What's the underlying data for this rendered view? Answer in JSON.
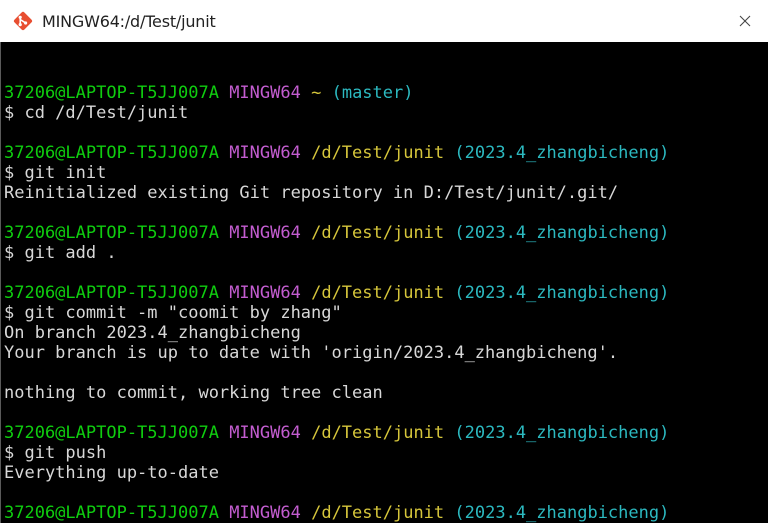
{
  "window": {
    "title": "MINGW64:/d/Test/junit"
  },
  "terminal": {
    "lines": [
      {
        "type": "blank"
      },
      {
        "type": "prompt",
        "user": "37206@LAPTOP-T5JJ007A",
        "sys": "MINGW64",
        "path": "~",
        "branch": "(master)"
      },
      {
        "type": "text",
        "text": "$ cd /d/Test/junit"
      },
      {
        "type": "blank"
      },
      {
        "type": "prompt",
        "user": "37206@LAPTOP-T5JJ007A",
        "sys": "MINGW64",
        "path": "/d/Test/junit",
        "branch": "(2023.4_zhangbicheng)"
      },
      {
        "type": "text",
        "text": "$ git init"
      },
      {
        "type": "text",
        "text": "Reinitialized existing Git repository in D:/Test/junit/.git/"
      },
      {
        "type": "blank"
      },
      {
        "type": "prompt",
        "user": "37206@LAPTOP-T5JJ007A",
        "sys": "MINGW64",
        "path": "/d/Test/junit",
        "branch": "(2023.4_zhangbicheng)"
      },
      {
        "type": "text",
        "text": "$ git add ."
      },
      {
        "type": "blank"
      },
      {
        "type": "prompt",
        "user": "37206@LAPTOP-T5JJ007A",
        "sys": "MINGW64",
        "path": "/d/Test/junit",
        "branch": "(2023.4_zhangbicheng)"
      },
      {
        "type": "text",
        "text": "$ git commit -m \"coomit by zhang\""
      },
      {
        "type": "text",
        "text": "On branch 2023.4_zhangbicheng"
      },
      {
        "type": "text",
        "text": "Your branch is up to date with 'origin/2023.4_zhangbicheng'."
      },
      {
        "type": "blank"
      },
      {
        "type": "text",
        "text": "nothing to commit, working tree clean"
      },
      {
        "type": "blank"
      },
      {
        "type": "prompt",
        "user": "37206@LAPTOP-T5JJ007A",
        "sys": "MINGW64",
        "path": "/d/Test/junit",
        "branch": "(2023.4_zhangbicheng)"
      },
      {
        "type": "text",
        "text": "$ git push"
      },
      {
        "type": "text",
        "text": "Everything up-to-date"
      },
      {
        "type": "blank"
      },
      {
        "type": "prompt",
        "user": "37206@LAPTOP-T5JJ007A",
        "sys": "MINGW64",
        "path": "/d/Test/junit",
        "branch": "(2023.4_zhangbicheng)"
      },
      {
        "type": "input",
        "text": "$"
      }
    ]
  },
  "colors": {
    "background": "#000000",
    "user": "#0fce0f",
    "mingw": "#c35dd0",
    "path": "#d6c63b",
    "branch": "#2cb9c0",
    "text": "#d8d8d8"
  },
  "icons": {
    "app": "git-logo-icon",
    "close": "close-icon"
  }
}
